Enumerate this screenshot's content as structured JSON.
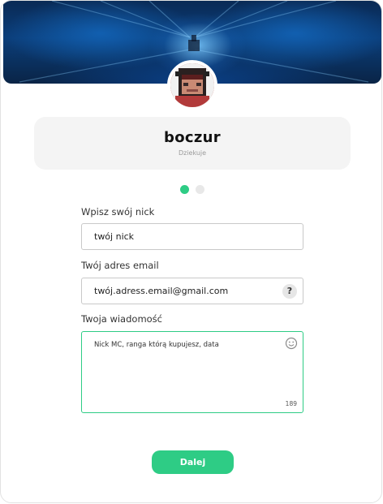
{
  "profile": {
    "username": "boczur",
    "subtitle": "Dziekuje"
  },
  "steps": {
    "count": 2,
    "active": 1
  },
  "form": {
    "nick": {
      "label": "Wpisz swój nick",
      "value": "twój nick"
    },
    "email": {
      "label": "Twój adres email",
      "value": "twój.adress.email@gmail.com",
      "help_icon": "?"
    },
    "message": {
      "label": "Twoja wiadomość",
      "value": "Nick MC, ranga którą kupujesz, data",
      "counter": "189",
      "emoji_icon": "smiley-icon"
    }
  },
  "actions": {
    "next_label": "Dalej"
  },
  "colors": {
    "accent": "#2ecc85",
    "banner": "#0b3e7a"
  }
}
